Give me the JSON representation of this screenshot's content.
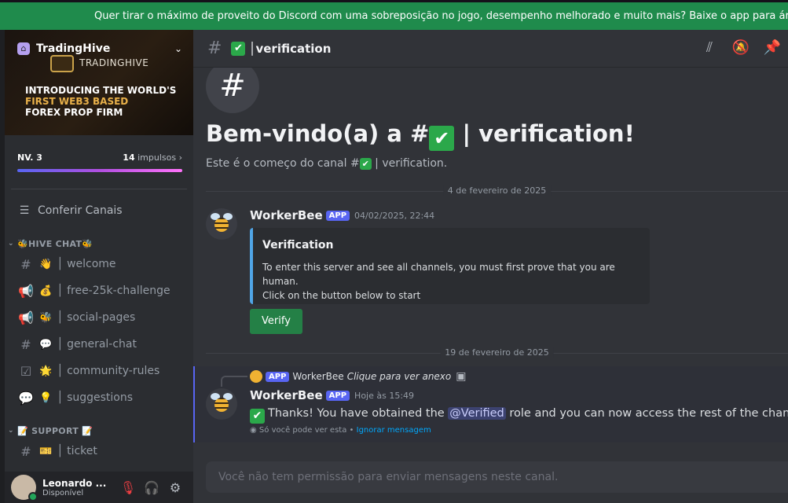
{
  "banner": {
    "text": "Quer tirar o máximo de proveito do Discord com uma sobreposição no jogo, desempenho melhorado e muito mais? Baixe o app para área de trabalho!"
  },
  "server": {
    "name": "TradingHive",
    "logo_text": "TRADINGHIVE",
    "banner_line1": "INTRODUCING THE WORLD'S",
    "banner_line2": "FIRST WEB3 BASED",
    "banner_line3": "FOREX PROP FIRM",
    "boost_level": "NV. 3",
    "boost_count": "14",
    "boost_label": "impulsos",
    "browse_channels": "Conferir Canais"
  },
  "categories": [
    {
      "name": "🐝HIVE CHAT🐝",
      "channels": [
        {
          "icon": "#",
          "emoji": "👋",
          "name": "welcome"
        },
        {
          "icon": "📢",
          "emoji": "💰",
          "name": "free-25k-challenge"
        },
        {
          "icon": "📢",
          "emoji": "🐝",
          "name": "social-pages"
        },
        {
          "icon": "#",
          "emoji": "💬",
          "name": "general-chat"
        },
        {
          "icon": "☑",
          "emoji": "🌟",
          "name": "community-rules"
        },
        {
          "icon": "💬",
          "emoji": "💡",
          "name": "suggestions"
        }
      ]
    },
    {
      "name": "📝 SUPPORT 📝",
      "channels": [
        {
          "icon": "#",
          "emoji": "🎫",
          "name": "ticket"
        }
      ]
    }
  ],
  "user": {
    "name": "Leonardo ...",
    "status": "Disponível"
  },
  "channel": {
    "name": "verification",
    "check": "✔",
    "hash": "#",
    "welcome_title_prefix": "Bem-vindo(a) a #",
    "welcome_title_suffix": "| verification!",
    "welcome_sub_prefix": "Este é o começo do canal #",
    "welcome_sub_suffix": "| verification."
  },
  "messages": {
    "date1": "4 de fevereiro de 2025",
    "date2": "19 de fevereiro de 2025",
    "msg1": {
      "author": "WorkerBee",
      "tag": "APP",
      "time": "04/02/2025, 22:44",
      "embed_title": "Verification",
      "embed_desc_line1": "To enter this server and see all channels, you must first prove that you are human.",
      "embed_desc_line2": "Click on the button below to start",
      "button": "Verify"
    },
    "msg2": {
      "reply_tag": "APP",
      "reply_author": "WorkerBee",
      "reply_text": "Clique para ver anexo",
      "author": "WorkerBee",
      "tag": "APP",
      "time": "Hoje às 15:49",
      "text_before": "Thanks! You have obtained the",
      "mention": "@Verified",
      "text_after": "role and you can now access the rest of the channels!! (",
      "ephemeral": "Só você pode ver esta •",
      "dismiss": "Ignorar mensagem"
    }
  },
  "composer": {
    "placeholder": "Você não tem permissão para enviar mensagens neste canal."
  },
  "colors": {
    "accent": "#5865f2",
    "success": "#248046",
    "banner": "#1f8b4c"
  }
}
